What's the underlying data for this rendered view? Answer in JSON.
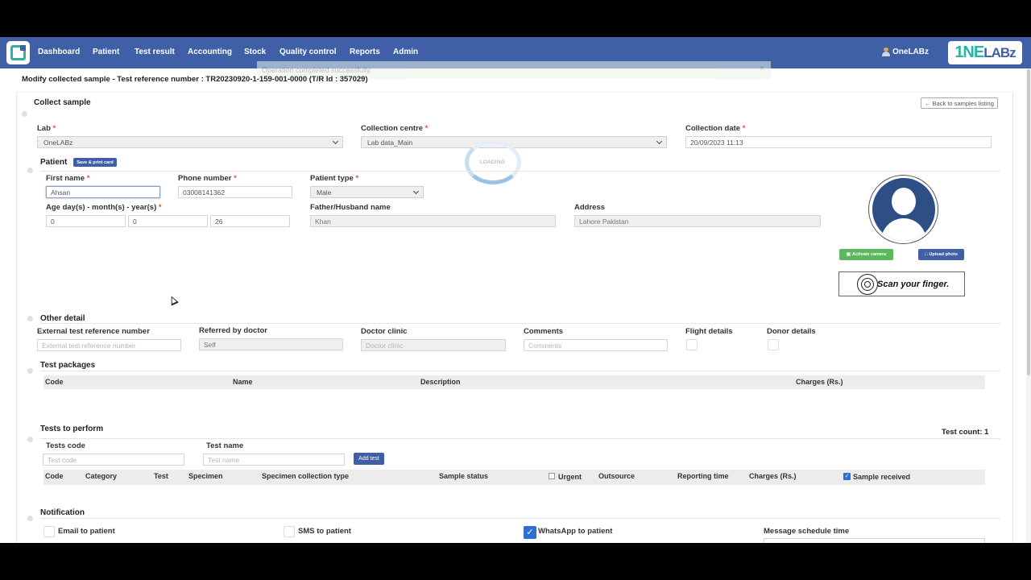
{
  "nav": {
    "items": [
      "Dashboard",
      "Patient",
      "Test result",
      "Accounting",
      "Stock",
      "Quality control",
      "Reports",
      "Admin"
    ],
    "user": "OneLABz",
    "brand_a": "1NE",
    "brand_b": "LABz"
  },
  "toast": {
    "message": "Operation completed successfully.",
    "close": "×"
  },
  "page_title": "Modify collected sample - Test reference number : TR20230920-1-159-001-0000 (T/R Id : 357029)",
  "collect": {
    "heading": "Collect sample",
    "back_label": "Back to samples listing",
    "lab_label": "Lab",
    "lab_value": "OneLABz",
    "centre_label": "Collection centre",
    "centre_value": "Lab data_Main",
    "date_label": "Collection date",
    "date_value": "20/09/2023 11:13",
    "required_mark": "*"
  },
  "loading": "LOADING",
  "patient": {
    "heading": "Patient",
    "save_print_label": "Save & print card",
    "first_name_label": "First name",
    "first_name_value": "Ahsan",
    "phone_label": "Phone number",
    "phone_value": "03008141362",
    "type_label": "Patient type",
    "type_value": "Male",
    "age_label": "Age day(s) - month(s) - year(s)",
    "age_days": "0",
    "age_months": "0",
    "age_years": "26",
    "father_label": "Father/Husband name",
    "father_value": "Khan",
    "address_label": "Address",
    "address_value": "Lahore Pakistan",
    "activate_camera": "Activate camera",
    "upload_photo": "Upload photo",
    "scan_text": "Scan your finger."
  },
  "other": {
    "heading": "Other detail",
    "ext_ref_label": "External test reference number",
    "ext_ref_placeholder": "External test reference number",
    "doctor_label": "Referred by doctor",
    "doctor_value": "Self",
    "clinic_label": "Doctor clinic",
    "clinic_placeholder": "Doctor clinic",
    "comments_label": "Comments",
    "comments_placeholder": "Comments",
    "flight_label": "Flight details",
    "donor_label": "Donor details"
  },
  "packages": {
    "heading": "Test packages",
    "columns": [
      "Code",
      "Name",
      "Description",
      "Charges (Rs.)"
    ]
  },
  "tests": {
    "heading": "Tests to perform",
    "count": "Test count: 1",
    "code_label": "Tests code",
    "code_placeholder": "Test code",
    "name_label": "Test name",
    "name_placeholder": "Test name",
    "add_label": "Add test",
    "columns": [
      "Code",
      "Category",
      "Test",
      "Specimen",
      "Specimen collection type",
      "Sample status",
      "Urgent",
      "Outsource",
      "Reporting time",
      "Charges (Rs.)",
      "Sample received"
    ]
  },
  "notification": {
    "heading": "Notification",
    "email_label": "Email to patient",
    "sms_label": "SMS to patient",
    "whatsapp_label": "WhatsApp to patient",
    "schedule_label": "Message schedule time"
  },
  "colors": {
    "navbar": "#3f5fa6",
    "accent": "#2bb3a3",
    "checkbox": "#2e6fd6",
    "required": "#d9534f"
  }
}
